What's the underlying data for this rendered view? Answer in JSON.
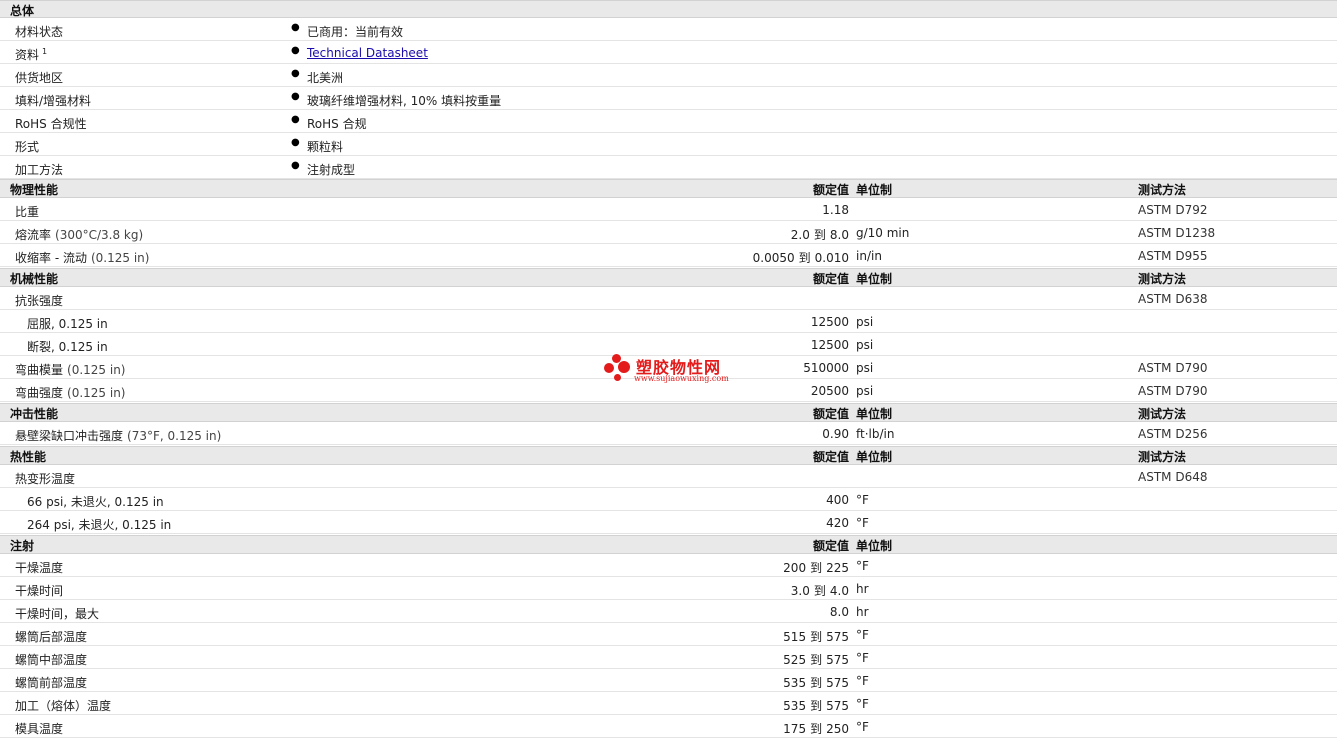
{
  "general": {
    "title": "总体",
    "rows": [
      {
        "label": "材料状态",
        "value": "已商用：当前有效"
      },
      {
        "label": "资料",
        "sup": "1",
        "link": "Technical Datasheet"
      },
      {
        "label": "供货地区",
        "value": "北美洲"
      },
      {
        "label": "填料/增强材料",
        "value": "玻璃纤维增强材料, 10% 填料按重量"
      },
      {
        "label": "RoHS 合规性",
        "value": "RoHS 合规"
      },
      {
        "label": "形式",
        "value": "颗粒料"
      },
      {
        "label": "加工方法",
        "value": "注射成型"
      }
    ]
  },
  "columns": {
    "nominal": "额定值",
    "unit": "单位制",
    "method": "测试方法"
  },
  "range_word": "到",
  "physical": {
    "title": "物理性能",
    "rows": [
      {
        "label": "比重",
        "value": "1.18",
        "unit": "",
        "method": "ASTM D792"
      },
      {
        "label": "熔流率",
        "cond": "(300°C/3.8 kg)",
        "from": "2.0",
        "to": "8.0",
        "unit": "g/10 min",
        "method": "ASTM D1238"
      },
      {
        "label": "收缩率 - 流动",
        "cond": "(0.125 in)",
        "from": "0.0050",
        "to": "0.010",
        "unit": "in/in",
        "method": "ASTM D955"
      }
    ]
  },
  "mechanical": {
    "title": "机械性能",
    "rows": [
      {
        "label": "抗张强度",
        "method": "ASTM D638"
      },
      {
        "label": "屈服, 0.125 in",
        "value": "12500",
        "unit": "psi"
      },
      {
        "label": "断裂, 0.125 in",
        "value": "12500",
        "unit": "psi"
      },
      {
        "label": "弯曲模量",
        "cond": "(0.125 in)",
        "value": "510000",
        "unit": "psi",
        "method": "ASTM D790"
      },
      {
        "label": "弯曲强度",
        "cond": "(0.125 in)",
        "value": "20500",
        "unit": "psi",
        "method": "ASTM D790"
      }
    ]
  },
  "impact": {
    "title": "冲击性能",
    "rows": [
      {
        "label": "悬壁梁缺口冲击强度",
        "cond": "(73°F, 0.125 in)",
        "value": "0.90",
        "unit": "ft·lb/in",
        "method": "ASTM D256"
      }
    ]
  },
  "thermal": {
    "title": "热性能",
    "rows": [
      {
        "label": "热变形温度",
        "method": "ASTM D648"
      },
      {
        "label": "66 psi, 未退火, 0.125 in",
        "value": "400",
        "unit": "°F"
      },
      {
        "label": "264 psi, 未退火, 0.125 in",
        "value": "420",
        "unit": "°F"
      }
    ]
  },
  "injection": {
    "title": "注射",
    "rows": [
      {
        "label": "干燥温度",
        "from": "200",
        "to": "225",
        "unit": "°F"
      },
      {
        "label": "干燥时间",
        "from": "3.0",
        "to": "4.0",
        "unit": "hr"
      },
      {
        "label": "干燥时间，最大",
        "value": "8.0",
        "unit": "hr"
      },
      {
        "label": "螺筒后部温度",
        "from": "515",
        "to": "575",
        "unit": "°F"
      },
      {
        "label": "螺筒中部温度",
        "from": "525",
        "to": "575",
        "unit": "°F"
      },
      {
        "label": "螺筒前部温度",
        "from": "535",
        "to": "575",
        "unit": "°F"
      },
      {
        "label": "加工（熔体）温度",
        "from": "535",
        "to": "575",
        "unit": "°F"
      },
      {
        "label": "模具温度",
        "from": "175",
        "to": "250",
        "unit": "°F"
      }
    ]
  },
  "watermark": {
    "name": "塑胶物性网",
    "url": "www.sujiaowuxing.com"
  }
}
